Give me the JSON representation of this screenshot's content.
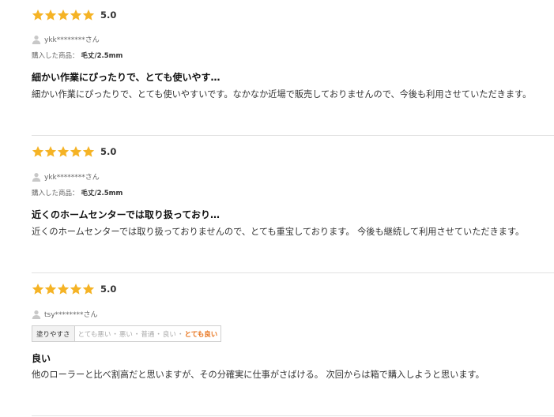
{
  "colors": {
    "star": "#f5b325",
    "selected_rating": "#e8731b"
  },
  "reviews": [
    {
      "score": "5.0",
      "stars": 5,
      "user": "ykk********さん",
      "purchase_label": "購入した商品：",
      "purchase_value": "毛丈/2.5mm",
      "title": "細かい作業にぴったりで、とても使いやす…",
      "body": "細かい作業にぴったりで、とても使いやすいです。なかなか近場で販売しておりませんので、今後も利用させていただきます。"
    },
    {
      "score": "5.0",
      "stars": 5,
      "user": "ykk********さん",
      "purchase_label": "購入した商品：",
      "purchase_value": "毛丈/2.5mm",
      "title": "近くのホームセンターでは取り扱っており…",
      "body": "近くのホームセンターでは取り扱っておりませんので、とても重宝しております。 今後も継続して利用させていただきます。"
    },
    {
      "score": "5.0",
      "stars": 5,
      "user": "tsy********さん",
      "rating_label": "塗りやすさ",
      "rating_options": [
        "とても悪い",
        "悪い",
        "普通",
        "良い",
        "とても良い"
      ],
      "rating_selected": "とても良い",
      "title": "良い",
      "body": "他のローラーと比べ割高だと思いますが、その分確実に仕事がさばける。 次回からは箱で購入しようと思います。"
    }
  ]
}
